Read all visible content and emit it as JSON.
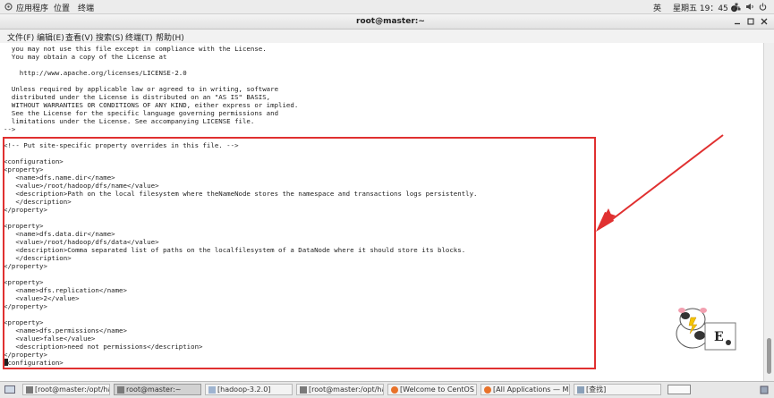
{
  "topbar": {
    "apps_label": "应用程序",
    "places_label": "位置",
    "terminal_label": "终端",
    "ime_label": "英",
    "clock": "星期五 19：45 ●"
  },
  "window": {
    "title": "root@master:~"
  },
  "menubar": {
    "items": [
      "文件(F)",
      "编辑(E)",
      "查看(V)",
      "搜索(S)",
      "终端(T)",
      "帮助(H)"
    ]
  },
  "terminal": {
    "lines": [
      "  you may not use this file except in compliance with the License.",
      "  You may obtain a copy of the License at",
      "",
      "    http://www.apache.org/licenses/LICENSE-2.0",
      "",
      "  Unless required by applicable law or agreed to in writing, software",
      "  distributed under the License is distributed on an \"AS IS\" BASIS,",
      "  WITHOUT WARRANTIES OR CONDITIONS OF ANY KIND, either express or implied.",
      "  See the License for the specific language governing permissions and",
      "  limitations under the License. See accompanying LICENSE file.",
      "-->",
      "",
      "<!-- Put site-specific property overrides in this file. -->",
      "",
      "<configuration>",
      "<property>",
      "   <name>dfs.name.dir</name>",
      "   <value>/root/hadoop/dfs/name</value>",
      "   <description>Path on the local filesystem where theNameNode stores the namespace and transactions logs persistently.",
      "   </description>",
      "</property>",
      "",
      "<property>",
      "   <name>dfs.data.dir</name>",
      "   <value>/root/hadoop/dfs/data</value>",
      "   <description>Comma separated list of paths on the localfilesystem of a DataNode where it should store its blocks.",
      "   </description>",
      "</property>",
      "",
      "<property>",
      "   <name>dfs.replication</name>",
      "   <value>2</value>",
      "</property>",
      "",
      "<property>",
      "   <name>dfs.permissions</name>",
      "   <value>false</value>",
      "   <description>need not permissions</description>",
      "</property>",
      " configuration>"
    ]
  },
  "taskbar": {
    "items": [
      "[root@master:/opt/hado···",
      "root@master:~",
      "[hadoop-3.2.0]",
      "[root@master:/opt/hado···",
      "[Welcome to CentOS — ···",
      "[All Applications — Mozil···",
      "[查找]"
    ]
  }
}
